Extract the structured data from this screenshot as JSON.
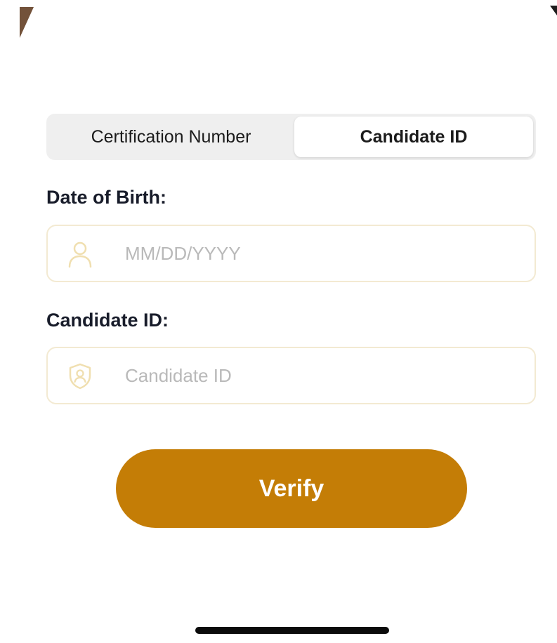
{
  "segmented_control": {
    "options": [
      {
        "label": "Certification Number",
        "selected": false
      },
      {
        "label": "Candidate ID",
        "selected": true
      }
    ]
  },
  "form": {
    "dob": {
      "label": "Date of Birth:",
      "placeholder": "MM/DD/YYYY",
      "value": "",
      "icon": "person-icon"
    },
    "candidate_id": {
      "label": "Candidate ID:",
      "placeholder": "Candidate ID",
      "value": "",
      "icon": "shield-user-icon"
    },
    "submit_label": "Verify"
  },
  "colors": {
    "accent": "#c47d06",
    "icon_tint": "#f0dfb0",
    "input_border": "#f3ead2",
    "placeholder": "#b9b9b9",
    "label": "#181c2a",
    "segment_bg": "#efefef"
  }
}
